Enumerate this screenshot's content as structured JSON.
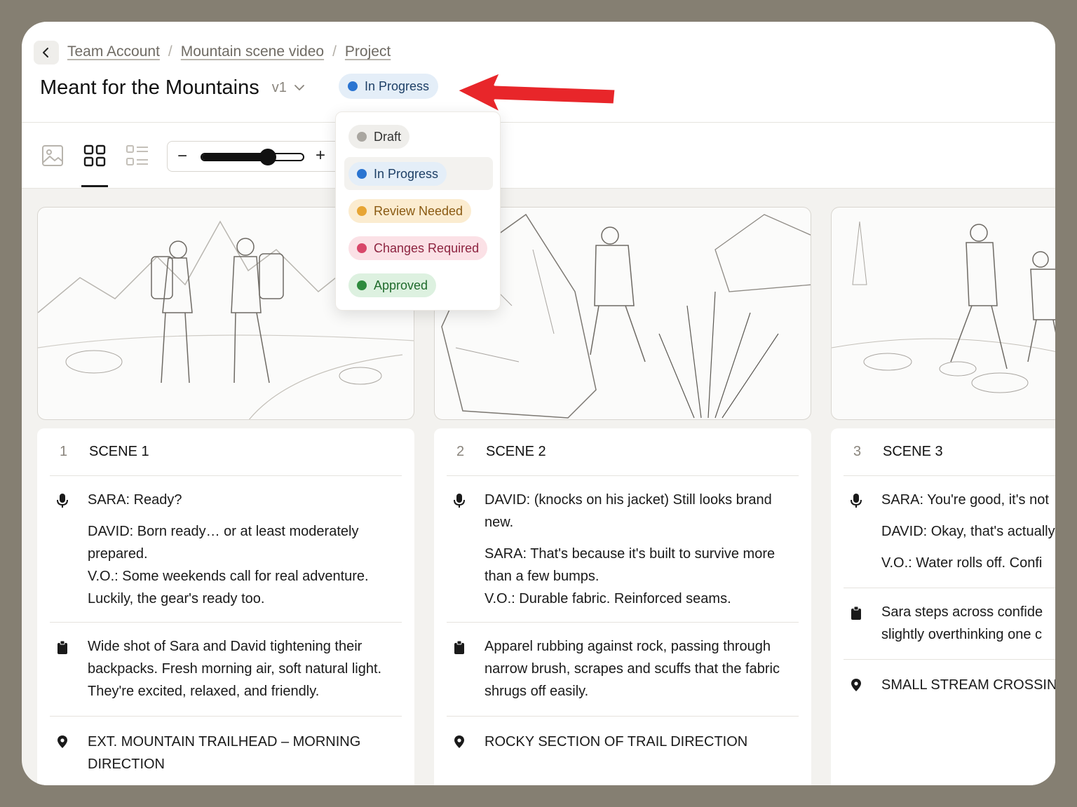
{
  "breadcrumb": [
    "Team Account",
    "Mountain scene video",
    "Project"
  ],
  "project": {
    "title": "Meant for the Mountains",
    "version": "v1",
    "status": "In Progress"
  },
  "status_colors": {
    "draft": "#a9a6a0",
    "in_progress": "#2a74d1",
    "review_needed": "#e7a534",
    "changes_required": "#d8476a",
    "approved": "#2e8b3e"
  },
  "status_menu": [
    {
      "label": "Draft",
      "dot": "#a9a6a0",
      "bg": "#efeeeb",
      "fg": "#333333"
    },
    {
      "label": "In Progress",
      "dot": "#2a74d1",
      "bg": "#e4eef8",
      "fg": "#1d3f66"
    },
    {
      "label": "Review Needed",
      "dot": "#e7a534",
      "bg": "#fbecd0",
      "fg": "#8a5a12"
    },
    {
      "label": "Changes Required",
      "dot": "#d8476a",
      "bg": "#fbe1e6",
      "fg": "#8d2440"
    },
    {
      "label": "Approved",
      "dot": "#2e8b3e",
      "bg": "#ddf1e0",
      "fg": "#1f6b2c"
    }
  ],
  "toolbar": {
    "zoom_minus": "−",
    "zoom_plus": "+",
    "zoom_level": 0.65
  },
  "scenes": [
    {
      "number": "1",
      "name": "SCENE 1",
      "dialogue": [
        "SARA: Ready?",
        "DAVID: Born ready… or at least moderately prepared.\nV.O.: Some weekends call for real adventure. Luckily, the gear's ready too."
      ],
      "description": "Wide shot of Sara and David tightening their backpacks. Fresh morning air, soft natural light. They're excited, relaxed, and friendly.",
      "location": "EXT. MOUNTAIN TRAILHEAD – MORNING DIRECTION"
    },
    {
      "number": "2",
      "name": "SCENE 2",
      "dialogue": [
        "DAVID: (knocks on his jacket) Still looks brand new.",
        "SARA: That's because it's built to survive more than a few bumps.\nV.O.: Durable fabric. Reinforced seams."
      ],
      "description": "Apparel rubbing against rock, passing through narrow brush, scrapes and scuffs that the fabric shrugs off easily.",
      "location": "ROCKY SECTION OF TRAIL DIRECTION"
    },
    {
      "number": "3",
      "name": "SCENE 3",
      "dialogue": [
        "SARA: You're good, it's not",
        "DAVID: Okay, that's actually",
        "V.O.: Water rolls off. Confi"
      ],
      "description": "Sara steps across confide slightly overthinking one c",
      "location": "SMALL STREAM CROSSIN"
    }
  ]
}
